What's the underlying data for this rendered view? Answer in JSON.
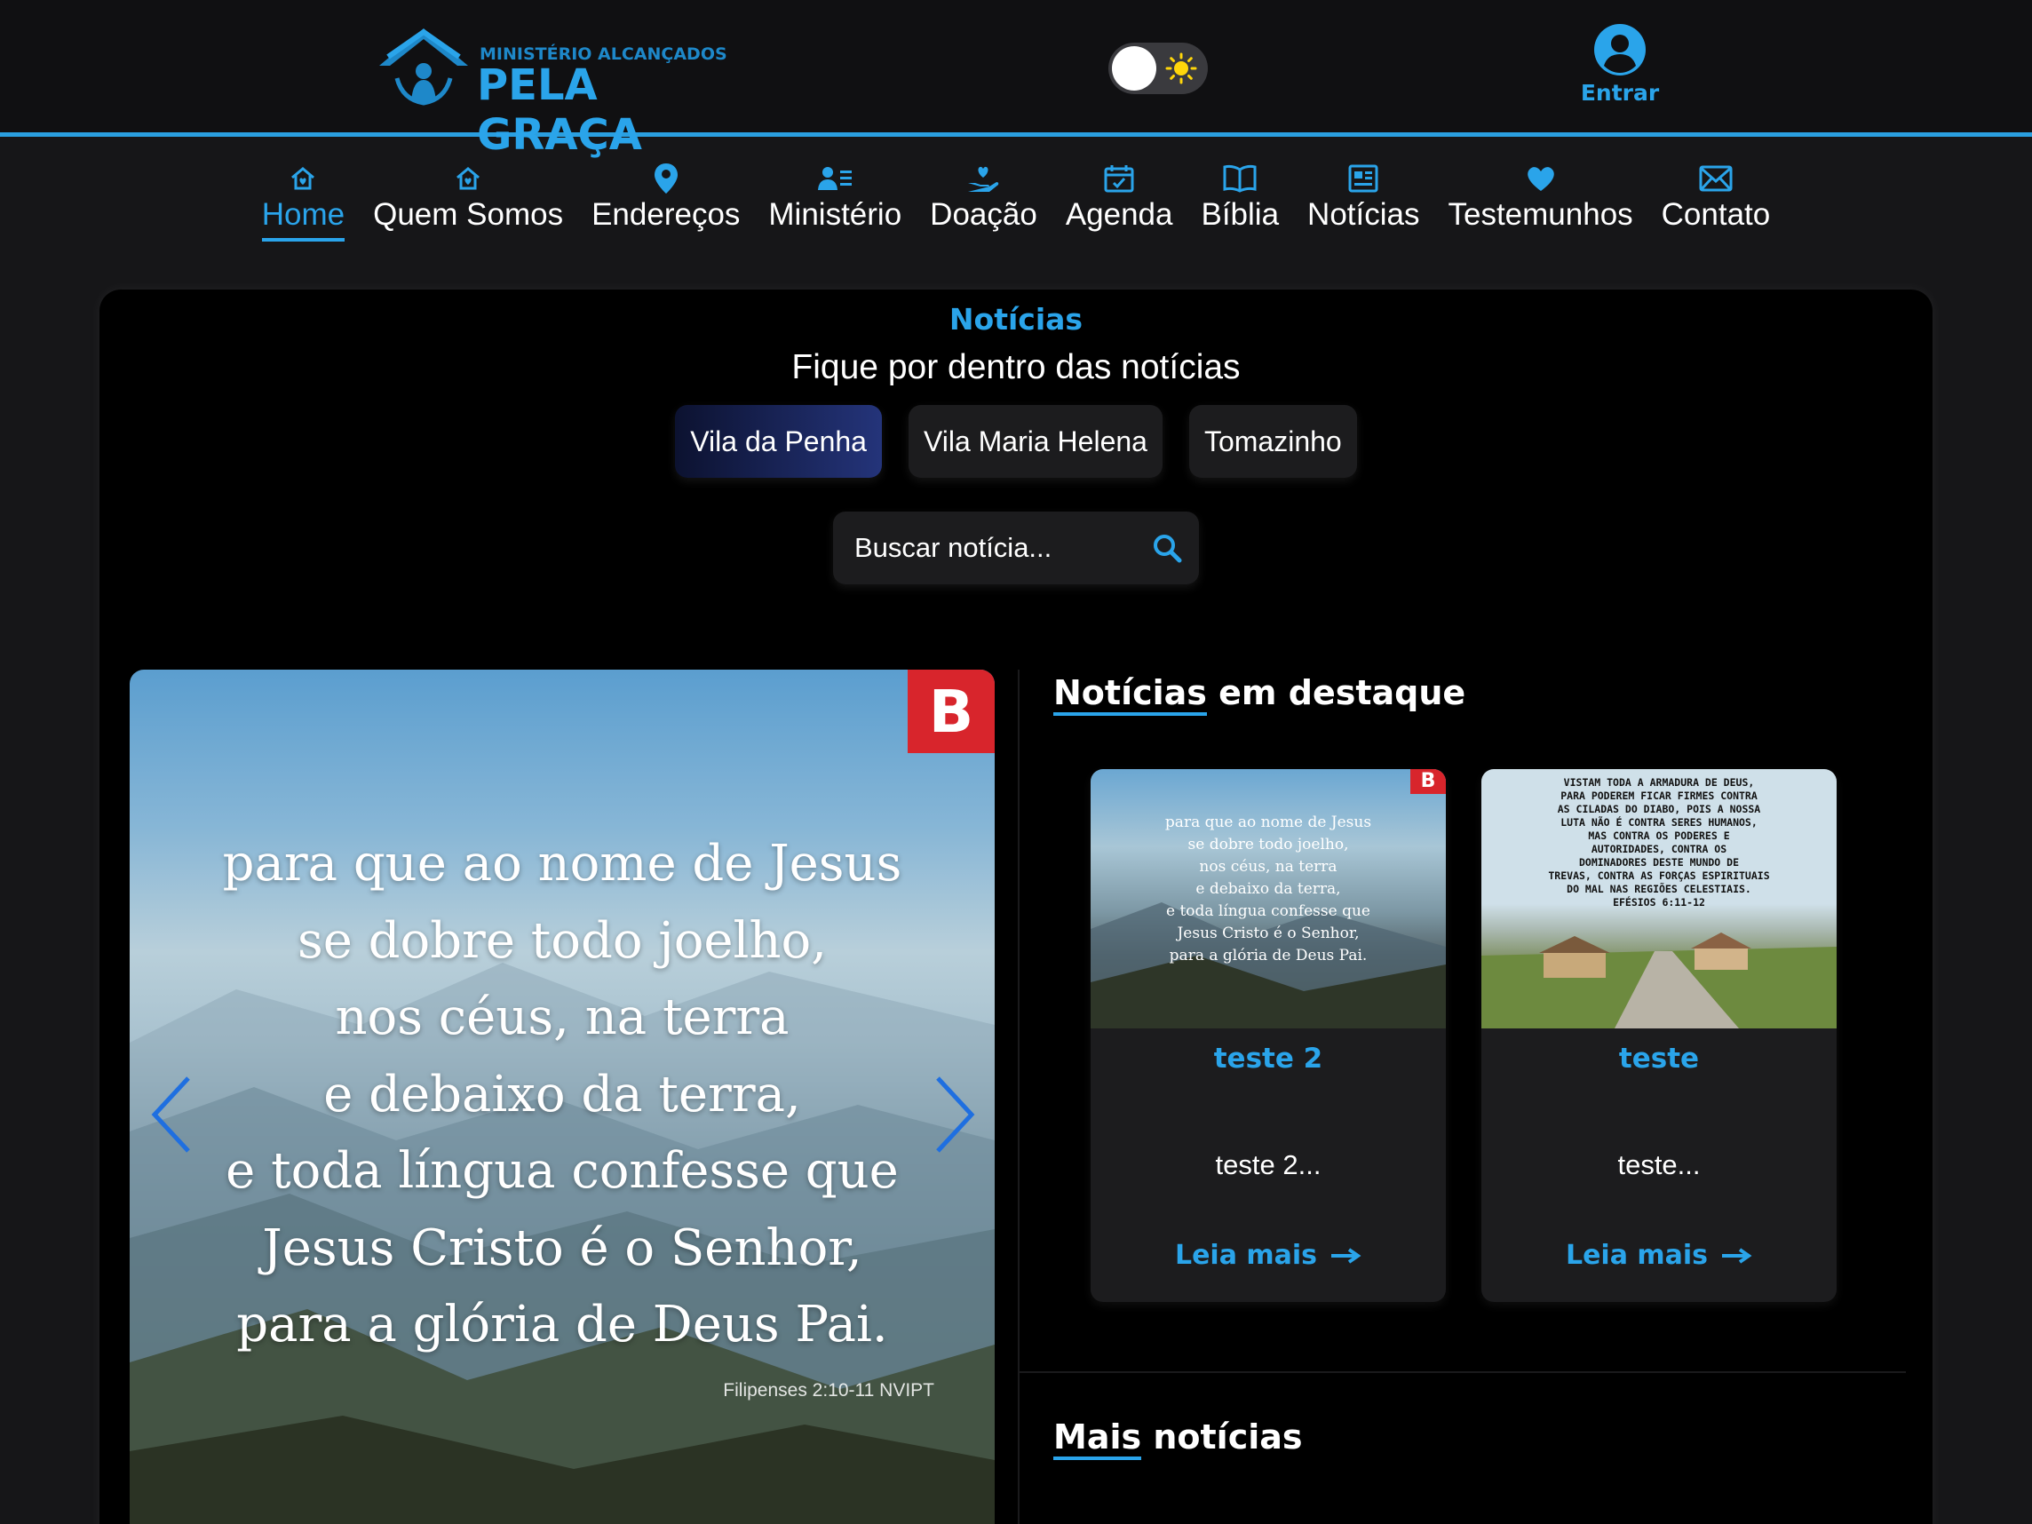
{
  "header": {
    "logo_small": "MINISTÉRIO ALCANÇADOS",
    "logo_big": "PELA GRAÇA",
    "login_label": "Entrar",
    "login_icon": "user-circle-icon",
    "theme_icon": "sun-icon"
  },
  "nav": {
    "items": [
      {
        "label": "Home",
        "icon": "home-icon"
      },
      {
        "label": "Quem Somos",
        "icon": "home-icon"
      },
      {
        "label": "Endereços",
        "icon": "map-pin-icon"
      },
      {
        "label": "Ministério",
        "icon": "users-icon"
      },
      {
        "label": "Doação",
        "icon": "donate-hand-icon"
      },
      {
        "label": "Agenda",
        "icon": "calendar-icon"
      },
      {
        "label": "Bíblia",
        "icon": "book-icon"
      },
      {
        "label": "Notícias",
        "icon": "newspaper-icon"
      },
      {
        "label": "Testemunhos",
        "icon": "heart-icon"
      },
      {
        "label": "Contato",
        "icon": "envelope-icon"
      }
    ],
    "active": "Home"
  },
  "news": {
    "section_label": "Notícias",
    "subtitle": "Fique por dentro das notícias",
    "filters": [
      "Vila da Penha",
      "Vila Maria Helena",
      "Tomazinho"
    ],
    "active_filter": "Vila da Penha",
    "search_placeholder": "Buscar notícia...",
    "search_icon": "search-icon"
  },
  "carousel": {
    "badge": "B",
    "verse_lines": [
      "para que ao nome de Jesus",
      "se dobre todo joelho,",
      "nos céus, na terra",
      "e debaixo da terra,",
      "e toda língua confesse que",
      "Jesus Cristo é o Senhor,",
      "para a glória de Deus Pai."
    ],
    "reference": "Filipenses 2:10-11 NVIPT"
  },
  "featured": {
    "title_part1": "Notícias",
    "title_part2": "em destaque",
    "cards": [
      {
        "title": "teste 2",
        "excerpt": "teste 2...",
        "link": "Leia mais",
        "thumb_badge": "B",
        "thumb_lines": [
          "para que ao nome de Jesus",
          "se dobre todo joelho,",
          "nos céus, na terra",
          "e debaixo da terra,",
          "e toda língua confesse que",
          "Jesus Cristo é o Senhor,",
          "para a glória de Deus Pai."
        ]
      },
      {
        "title": "teste",
        "excerpt": "teste...",
        "link": "Leia mais",
        "thumb_lines": [
          "VISTAM TODA A ARMADURA DE DEUS,",
          "PARA PODEREM FICAR FIRMES CONTRA",
          "AS CILADAS DO DIABO, POIS A NOSSA",
          "LUTA NÃO É CONTRA SERES HUMANOS,",
          "MAS CONTRA OS PODERES E",
          "AUTORIDADES, CONTRA OS",
          "DOMINADORES DESTE MUNDO DE",
          "TREVAS, CONTRA AS FORÇAS ESPIRITUAIS",
          "DO MAL NAS REGIÕES CELESTIAIS.",
          "EFÉSIOS 6:11-12"
        ]
      }
    ]
  },
  "more": {
    "title_part1": "Mais",
    "title_part2": "notícias"
  },
  "colors": {
    "accent": "#2aa4ea",
    "background": "#161618",
    "panel": "#000000",
    "card": "#1c1c1e",
    "badge_red": "#d8252c"
  }
}
